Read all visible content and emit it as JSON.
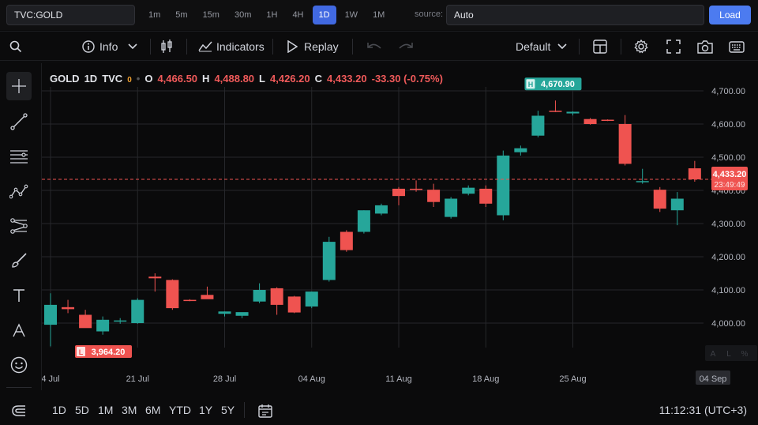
{
  "topbar": {
    "symbol": "TVC:GOLD",
    "intervals": [
      "1m",
      "5m",
      "15m",
      "30m",
      "1H",
      "4H",
      "1D",
      "1W",
      "1M"
    ],
    "active_interval": "1D",
    "source_label": "source:",
    "source_value": "Auto",
    "load_label": "Load"
  },
  "toolbar": {
    "info_label": "Info",
    "indicators_label": "Indicators",
    "replay_label": "Replay",
    "layout_label": "Default"
  },
  "legend": {
    "symbol": "GOLD",
    "interval": "1D",
    "exchange": "TVC",
    "zero": "0",
    "dot": "•",
    "o_label": "O",
    "o_value": "4,466.50",
    "h_label": "H",
    "h_value": "4,488.80",
    "l_label": "L",
    "l_value": "4,426.20",
    "c_label": "C",
    "c_value": "4,433.20",
    "change": "-33.30 (-0.75%)"
  },
  "bottombar": {
    "ranges": [
      "1D",
      "5D",
      "1M",
      "3M",
      "6M",
      "YTD",
      "1Y",
      "5Y"
    ],
    "clock": "11:12:31 (UTC+3)"
  },
  "colors": {
    "up": "#26a69a",
    "down": "#ef5350",
    "accent": "#4169e1"
  },
  "chart_data": {
    "type": "candlestick",
    "yticks": [
      4000,
      4100,
      4200,
      4300,
      4400,
      4500,
      4600,
      4700
    ],
    "ytick_labels": [
      "4,000.00",
      "4,100.00",
      "4,200.00",
      "4,300.00",
      "4,400.00",
      "4,500.00",
      "4,600.00",
      "4,700.00"
    ],
    "xtick_labels": [
      "4 Jul",
      "21 Jul",
      "28 Jul",
      "04 Aug",
      "11 Aug",
      "18 Aug",
      "25 Aug",
      "04 Sep"
    ],
    "xtick_index": [
      0,
      5,
      10,
      15,
      20,
      25,
      30,
      37
    ],
    "ylim": [
      3930,
      4740
    ],
    "candles": [
      {
        "o": 3995,
        "h": 4090,
        "l": 3930,
        "c": 4055
      },
      {
        "o": 4048,
        "h": 4070,
        "l": 4030,
        "c": 4042
      },
      {
        "o": 4025,
        "h": 4040,
        "l": 3990,
        "c": 3985
      },
      {
        "o": 3975,
        "h": 4020,
        "l": 3965,
        "c": 4010
      },
      {
        "o": 4005,
        "h": 4015,
        "l": 3998,
        "c": 4008
      },
      {
        "o": 4000,
        "h": 4075,
        "l": 3998,
        "c": 4070
      },
      {
        "o": 4140,
        "h": 4150,
        "l": 4095,
        "c": 4135
      },
      {
        "o": 4130,
        "h": 4132,
        "l": 4040,
        "c": 4045
      },
      {
        "o": 4070,
        "h": 4072,
        "l": 4066,
        "c": 4068
      },
      {
        "o": 4085,
        "h": 4110,
        "l": 4075,
        "c": 4072
      },
      {
        "o": 4028,
        "h": 4035,
        "l": 4020,
        "c": 4035
      },
      {
        "o": 4022,
        "h": 4030,
        "l": 4015,
        "c": 4033
      },
      {
        "o": 4065,
        "h": 4120,
        "l": 4060,
        "c": 4100
      },
      {
        "o": 4105,
        "h": 4108,
        "l": 4025,
        "c": 4055
      },
      {
        "o": 4080,
        "h": 4082,
        "l": 4030,
        "c": 4032
      },
      {
        "o": 4050,
        "h": 4095,
        "l": 4045,
        "c": 4095
      },
      {
        "o": 4130,
        "h": 4260,
        "l": 4125,
        "c": 4245
      },
      {
        "o": 4275,
        "h": 4280,
        "l": 4215,
        "c": 4220
      },
      {
        "o": 4275,
        "h": 4340,
        "l": 4270,
        "c": 4340
      },
      {
        "o": 4330,
        "h": 4360,
        "l": 4325,
        "c": 4355
      },
      {
        "o": 4405,
        "h": 4410,
        "l": 4355,
        "c": 4383
      },
      {
        "o": 4405,
        "h": 4430,
        "l": 4396,
        "c": 4402
      },
      {
        "o": 4402,
        "h": 4420,
        "l": 4350,
        "c": 4365
      },
      {
        "o": 4320,
        "h": 4380,
        "l": 4315,
        "c": 4375
      },
      {
        "o": 4390,
        "h": 4415,
        "l": 4385,
        "c": 4408
      },
      {
        "o": 4405,
        "h": 4415,
        "l": 4350,
        "c": 4360
      },
      {
        "o": 4325,
        "h": 4520,
        "l": 4310,
        "c": 4505
      },
      {
        "o": 4515,
        "h": 4535,
        "l": 4505,
        "c": 4527
      },
      {
        "o": 4565,
        "h": 4640,
        "l": 4560,
        "c": 4625
      },
      {
        "o": 4640,
        "h": 4670.9,
        "l": 4636,
        "c": 4638
      },
      {
        "o": 4632,
        "h": 4638,
        "l": 4626,
        "c": 4637
      },
      {
        "o": 4615,
        "h": 4618,
        "l": 4598,
        "c": 4600
      },
      {
        "o": 4613,
        "h": 4614,
        "l": 4609,
        "c": 4612
      },
      {
        "o": 4600,
        "h": 4627,
        "l": 4475,
        "c": 4480
      },
      {
        "o": 4425,
        "h": 4465,
        "l": 4420,
        "c": 4428
      },
      {
        "o": 4402,
        "h": 4410,
        "l": 4335,
        "c": 4345
      },
      {
        "o": 4340,
        "h": 4395,
        "l": 4295,
        "c": 4375
      },
      {
        "o": 4466.5,
        "h": 4488.8,
        "l": 4426.2,
        "c": 4433.2
      }
    ],
    "high_marker": {
      "label": "H",
      "value": "4,670.90"
    },
    "low_marker": {
      "label": "L",
      "value": "3,964.20"
    },
    "last_price": {
      "value": 4433.2,
      "label": "4,433.20",
      "countdown": "23:49:49"
    }
  }
}
